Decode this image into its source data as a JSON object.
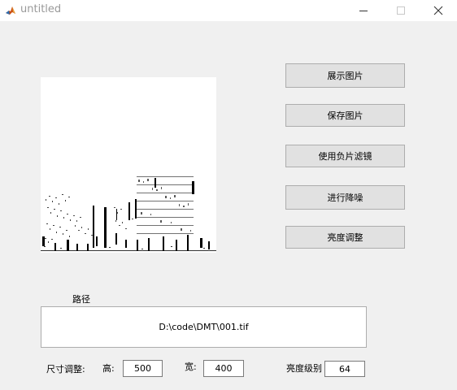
{
  "window": {
    "title": "untitled",
    "app_icon": "matlab-icon",
    "controls": [
      "minimize-icon",
      "maximize-icon",
      "close-icon"
    ]
  },
  "image_panel": {
    "content": "thresholded black-and-white building photo"
  },
  "buttons": {
    "show_image": "展示图片",
    "save_image": "保存图片",
    "negative_filter": "使用负片滤镜",
    "denoise": "进行降噪",
    "brightness": "亮度调整"
  },
  "path": {
    "label": "路径",
    "value": "D:\\code\\DMT\\001.tif"
  },
  "resize": {
    "label": "尺寸调整:",
    "height_label": "高:",
    "height_value": "500",
    "width_label": "宽:",
    "width_value": "400"
  },
  "brightness_level": {
    "label": "亮度级别",
    "value": "64"
  },
  "colors": {
    "window_bg": "#f0f0f0",
    "button_bg": "#e1e1e1",
    "button_border": "#adadad"
  }
}
